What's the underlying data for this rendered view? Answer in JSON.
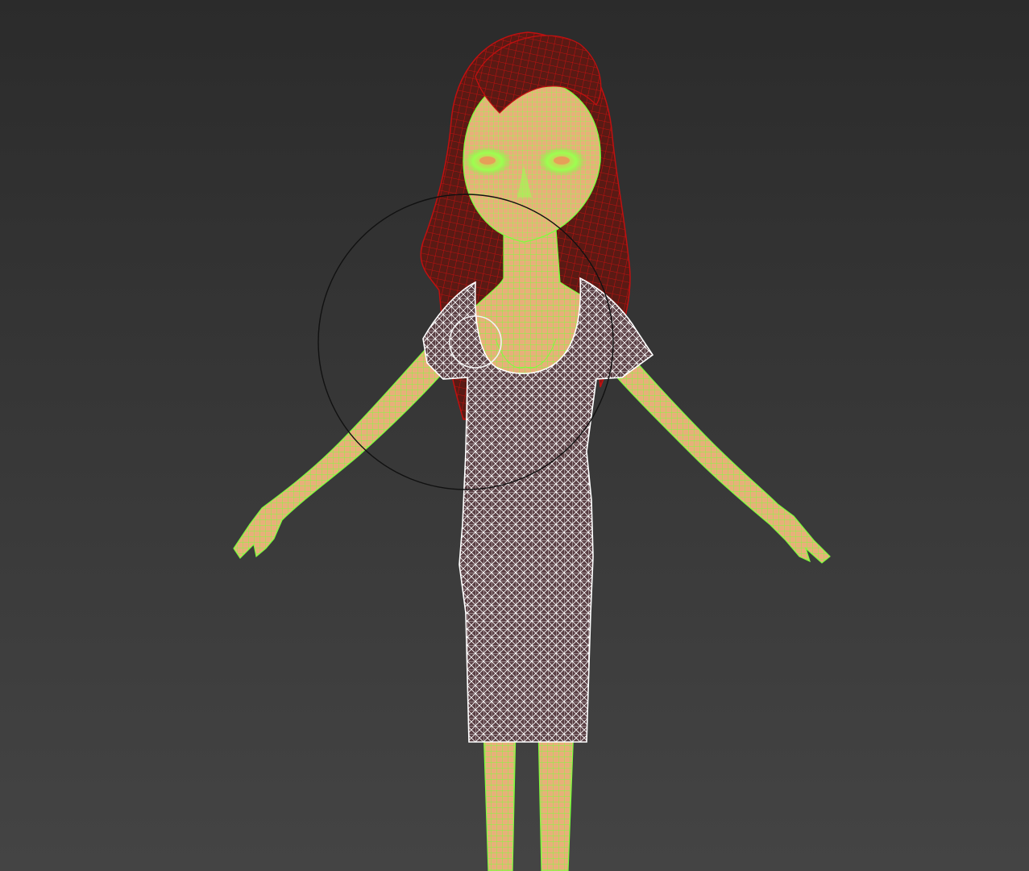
{
  "viewport": {
    "background_top": "#2b2b2b",
    "background_bottom": "#444444"
  },
  "model": {
    "skin_color": "#e8b07a",
    "skin_wire_color": "#7cff3c",
    "hair_color": "#5a1a14",
    "hair_wire_color": "#c01010",
    "dress_fill_color": "#5a3f44",
    "dress_wire_color": "#ffffff"
  },
  "gizmo": {
    "type": "rotate-gizmo",
    "color": "#111111"
  }
}
